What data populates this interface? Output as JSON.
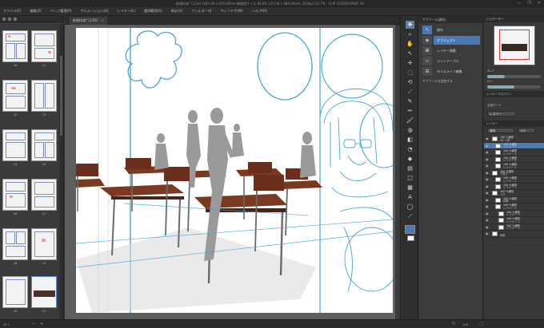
{
  "window": {
    "title": "新規作成* (1/34) [187.00 x 420.00mm 解像度サイズ 84.6% 372.00 x 384.00mm 350dpi] 32.7% - CLIP STUDIO PAINT EX",
    "controls": [
      "—",
      "❐",
      "✕"
    ]
  },
  "menubar": {
    "items": [
      "ファイル(F)",
      "編集(E)",
      "ページ管理(P)",
      "アニメーション(A)",
      "レイヤー(L)",
      "選択範囲(S)",
      "表示(V)",
      "フィルター(I)",
      "ウィンドウ(W)",
      "ヘルプ(H)"
    ]
  },
  "canvas": {
    "tab_label": "新規作成* (1/34)",
    "tab_close": "×"
  },
  "page_panel": {
    "pages": [
      {
        "left": "10",
        "right": "11"
      },
      {
        "left": "12",
        "right": "13"
      },
      {
        "left": "14",
        "right": "15"
      },
      {
        "left": "16",
        "right": "17"
      },
      {
        "left": "18",
        "right": "19"
      },
      {
        "left": "20",
        "right": "21"
      }
    ]
  },
  "subtool": {
    "header": "サブツール[操作]",
    "groups": [
      {
        "icon": "↖",
        "label": "操作"
      },
      {
        "icon": "◈",
        "label": "オブジェクト"
      },
      {
        "icon": "⊞",
        "label": "レイヤー移動"
      },
      {
        "icon": "⊹",
        "label": "ライトテーブル"
      },
      {
        "icon": "⊟",
        "label": "タイムライン編集"
      }
    ],
    "add_label": "サブツールを追加する"
  },
  "right_panel": {
    "navigator_header": "ナビゲーター",
    "zoom_value": "32.7",
    "rotate_value": "0.0",
    "property_header": "レイヤープロパティ",
    "blend_label": "合成モード",
    "color_field": "カラー",
    "layer_header": "レイヤー",
    "blend_mode": "通常",
    "opacity": "100",
    "layers": [
      {
        "name": "100 %通常",
        "sub": "3D 人物",
        "sel": false
      },
      {
        "name": "100 %通常",
        "sub": "レイヤー 1",
        "sel": true
      },
      {
        "name": "100 %通常",
        "sub": "レイヤー 3",
        "sel": false
      },
      {
        "name": "100 %通常",
        "sub": "レイヤー 4",
        "sel": false
      },
      {
        "name": "100 %通常",
        "sub": "レイヤー 5",
        "sel": false
      },
      {
        "name": "100 %通常",
        "sub": "下描き",
        "sel": false
      },
      {
        "name": "100 %通常",
        "sub": "レイヤー 2",
        "sel": false
      },
      {
        "name": "100 %通常",
        "sub": "レイヤー 1",
        "sel": false
      },
      {
        "name": "100 %通常",
        "sub": "コマ",
        "sel": false
      },
      {
        "name": "100 %通常",
        "sub": "枠線",
        "sel": false
      },
      {
        "name": "100 %通常",
        "sub": "レイヤー 3",
        "sel": false
      },
      {
        "name": "100 %通常",
        "sub": "レイヤー 1",
        "sel": false
      },
      {
        "name": "100 %通常",
        "sub": "レイヤー 2",
        "sel": false
      },
      {
        "name": "100 %通常",
        "sub": "レイヤー 1",
        "sel": false
      },
      {
        "name": "",
        "sub": "用紙",
        "sel": false
      }
    ]
  },
  "statusbar": {
    "zoom": "32.7",
    "percent": "100"
  },
  "colors": {
    "accent": "#4b79b6",
    "sketch_blue": "#4aa6d6",
    "desk_top": "#7a3a22"
  }
}
